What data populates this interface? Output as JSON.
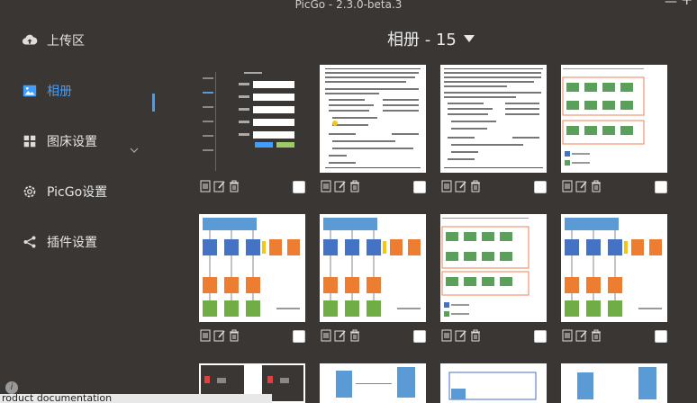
{
  "window": {
    "title": "PicGo - 2.3.0-beta.3",
    "minimize": "—",
    "new": "+"
  },
  "sidebar": {
    "items": [
      {
        "label": "上传区",
        "icon": "cloud-upload-icon"
      },
      {
        "label": "相册",
        "icon": "image-icon"
      },
      {
        "label": "图床设置",
        "icon": "grid-icon"
      },
      {
        "label": "PicGo设置",
        "icon": "gear-icon"
      },
      {
        "label": "插件设置",
        "icon": "share-icon"
      }
    ],
    "active_index": 1
  },
  "main": {
    "album_title": "相册 - 15"
  },
  "footer": {
    "info": "i",
    "partial_text": "roduct documentation"
  },
  "colors": {
    "accent": "#409eff",
    "background": "#3a3633"
  }
}
